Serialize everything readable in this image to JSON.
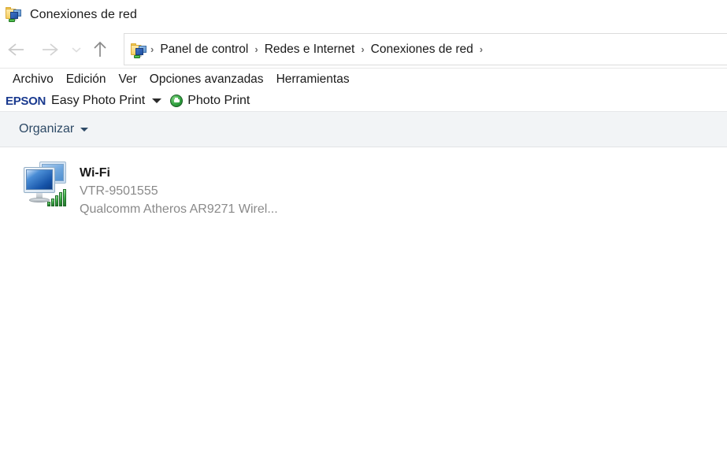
{
  "window": {
    "title": "Conexiones de red",
    "icon": "network-folder-icon"
  },
  "navigation": {
    "back_icon": "back-arrow-icon",
    "forward_icon": "forward-arrow-icon",
    "recent_icon": "chevron-down-icon",
    "up_icon": "up-arrow-icon",
    "address_icon": "network-folder-icon",
    "separator": "›",
    "breadcrumbs": [
      {
        "label": "Panel de control"
      },
      {
        "label": "Redes e Internet"
      },
      {
        "label": "Conexiones de red"
      }
    ]
  },
  "menubar": {
    "items": [
      {
        "label": "Archivo"
      },
      {
        "label": "Edición"
      },
      {
        "label": "Ver"
      },
      {
        "label": "Opciones avanzadas"
      },
      {
        "label": "Herramientas"
      }
    ]
  },
  "epson_toolbar": {
    "brand": "EPSON",
    "easy_photo_print_label": "Easy Photo Print",
    "dropdown_icon": "caret-down-icon",
    "photo_print_icon": "printer-circle-icon",
    "photo_print_label": "Photo Print",
    "brand_color": "#1a3a8f",
    "icon_color": "#2e9e3e"
  },
  "command_bar": {
    "organize_label": "Organizar",
    "organize_caret_icon": "caret-down-icon",
    "background_color": "#f2f4f6",
    "text_color": "#2e4a66"
  },
  "connections": [
    {
      "icon": "network-adapter-wireless-icon",
      "name": "Wi-Fi",
      "network": "VTR-9501555",
      "adapter": "Qualcomm Atheros AR9271 Wirel..."
    }
  ]
}
